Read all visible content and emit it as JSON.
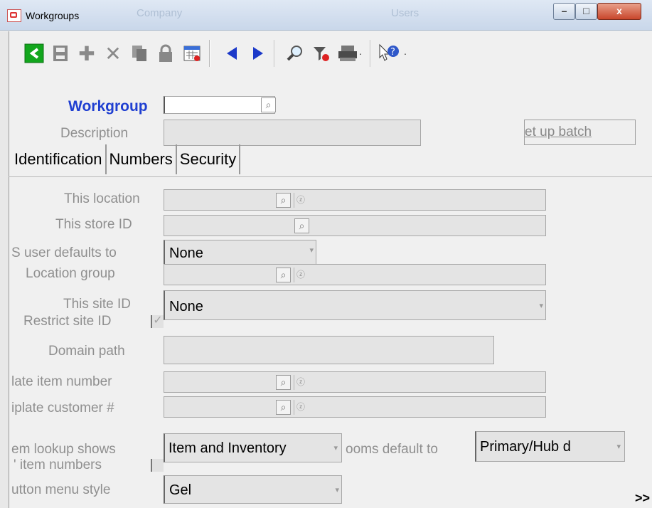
{
  "window": {
    "title": "Workgroups",
    "ghost_titles": [
      "Company",
      "Users"
    ],
    "controls": {
      "minimize": "–",
      "maximize": "□",
      "close": "x"
    }
  },
  "toolbar": {
    "icons": [
      "back-icon",
      "save-icon",
      "add-icon",
      "delete-icon",
      "copy-icon",
      "lock-icon",
      "calendar-icon",
      "previous-icon",
      "next-icon",
      "search-icon",
      "filter-icon",
      "print-icon",
      "print-dropdown-icon",
      "help-icon",
      "help-dropdown-icon"
    ]
  },
  "form": {
    "workgroup_label": "Workgroup",
    "workgroup_value": "",
    "description_label": "Description",
    "description_value": "",
    "setup_batch_label": "et up batch"
  },
  "tabs": [
    {
      "label": "Identification"
    },
    {
      "label": "Numbers"
    },
    {
      "label": "Security"
    }
  ],
  "identification": {
    "this_location_label": "This location",
    "this_store_id_label": "This store ID",
    "user_defaults_label": "S user defaults to",
    "user_defaults_value": "None",
    "location_group_label": "Location group",
    "this_site_id_label": "This site ID",
    "this_site_id_value": "None",
    "restrict_site_id_label": "Restrict site ID",
    "domain_path_label": "Domain path",
    "template_item_number_label": "late item number",
    "template_customer_label": "iplate customer #",
    "item_lookup_label": "em lookup shows",
    "item_lookup_value": "Item and Inventory",
    "rooms_default_label": "ooms default to",
    "rooms_default_value": "Primary/Hub d",
    "item_numbers_label": "' item numbers",
    "button_menu_style_label": "utton menu style",
    "button_menu_style_value": "Gel"
  },
  "footer": {
    "more_label": ">>"
  }
}
